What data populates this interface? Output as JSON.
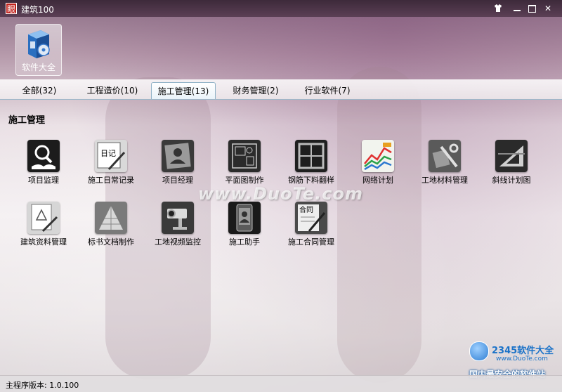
{
  "window": {
    "title": "建筑100",
    "logo_text": "眼"
  },
  "top_tile": {
    "label": "软件大全",
    "icon": "software-box-icon"
  },
  "tabs": [
    {
      "label": "全部(32)",
      "active": false
    },
    {
      "label": "工程造价(10)",
      "active": false
    },
    {
      "label": "施工管理(13)",
      "active": true
    },
    {
      "label": "财务管理(2)",
      "active": false
    },
    {
      "label": "行业软件(7)",
      "active": false
    }
  ],
  "section_title": "施工管理",
  "apps": [
    {
      "label": "项目监理",
      "icon": "magnifier-book-icon"
    },
    {
      "label": "施工日常记录",
      "icon": "diary-pen-icon",
      "icon_text": "日记"
    },
    {
      "label": "项目经理",
      "icon": "manager-portrait-icon"
    },
    {
      "label": "平面图制作",
      "icon": "floor-plan-icon"
    },
    {
      "label": "钢筋下料翻样",
      "icon": "rebar-frame-icon"
    },
    {
      "label": "网络计划",
      "icon": "network-chart-icon"
    },
    {
      "label": "工地材料管理",
      "icon": "materials-tools-icon"
    },
    {
      "label": "斜线计划图",
      "icon": "triangle-ruler-icon"
    },
    {
      "label": "建筑资料管理",
      "icon": "document-pen-icon"
    },
    {
      "label": "标书文档制作",
      "icon": "tender-document-icon"
    },
    {
      "label": "工地视频监控",
      "icon": "security-camera-icon"
    },
    {
      "label": "施工助手",
      "icon": "assistant-phone-icon"
    },
    {
      "label": "施工合同管理",
      "icon": "contract-pen-icon",
      "icon_text": "合同"
    }
  ],
  "watermarks": {
    "duote": "www.DuoTe.com",
    "brand": "2345软件大全",
    "brand_url": "www.DuoTe.com",
    "slogan": "国内最安全的软件站"
  },
  "status": {
    "version_text": "主程序版本: 1.0.100"
  },
  "colors": {
    "titlebar": "#4b3447",
    "tab_border": "#8fb1c6",
    "accent_blue": "#1a72c8"
  }
}
